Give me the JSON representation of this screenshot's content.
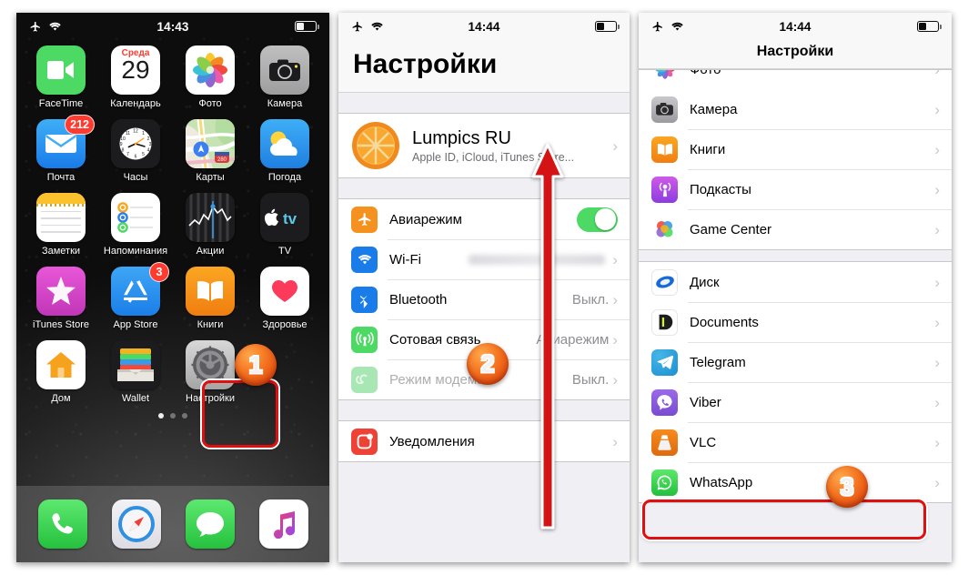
{
  "home_screen": {
    "status": {
      "time": "14:43",
      "airplane_icon": "airplane-mode-icon",
      "wifi_icon": "wifi-icon",
      "battery_icon": "battery-icon"
    },
    "apps": [
      {
        "label": "FaceTime",
        "icon": "facetime-icon",
        "badge": ""
      },
      {
        "label": "Календарь",
        "icon": "calendar-icon",
        "badge": "",
        "weekday": "Среда",
        "day": "29"
      },
      {
        "label": "Фото",
        "icon": "photos-icon",
        "badge": ""
      },
      {
        "label": "Камера",
        "icon": "camera-icon",
        "badge": ""
      },
      {
        "label": "Почта",
        "icon": "mail-icon",
        "badge": "212"
      },
      {
        "label": "Часы",
        "icon": "clock-icon",
        "badge": ""
      },
      {
        "label": "Карты",
        "icon": "maps-icon",
        "badge": "",
        "shield": "280"
      },
      {
        "label": "Погода",
        "icon": "weather-icon",
        "badge": ""
      },
      {
        "label": "Заметки",
        "icon": "notes-icon",
        "badge": ""
      },
      {
        "label": "Напоминания",
        "icon": "reminders-icon",
        "badge": ""
      },
      {
        "label": "Акции",
        "icon": "stocks-icon",
        "badge": ""
      },
      {
        "label": "TV",
        "icon": "apple-tv-icon",
        "badge": ""
      },
      {
        "label": "iTunes Store",
        "icon": "itunes-store-icon",
        "badge": ""
      },
      {
        "label": "App Store",
        "icon": "app-store-icon",
        "badge": "3"
      },
      {
        "label": "Книги",
        "icon": "books-icon",
        "badge": ""
      },
      {
        "label": "Здоровье",
        "icon": "health-icon",
        "badge": ""
      },
      {
        "label": "Дом",
        "icon": "home-app-icon",
        "badge": ""
      },
      {
        "label": "Wallet",
        "icon": "wallet-icon",
        "badge": ""
      },
      {
        "label": "Настройки",
        "icon": "settings-icon",
        "badge": ""
      }
    ],
    "page_dots": {
      "count": 3,
      "active_index": 0
    },
    "dock": [
      {
        "label": "Телефон",
        "icon": "phone-icon"
      },
      {
        "label": "Safari",
        "icon": "safari-icon"
      },
      {
        "label": "Сообщения",
        "icon": "messages-icon"
      },
      {
        "label": "Музыка",
        "icon": "music-icon"
      }
    ]
  },
  "settings_screen": {
    "status": {
      "time": "14:44",
      "airplane_icon": "airplane-mode-icon",
      "wifi_icon": "wifi-icon",
      "battery_icon": "battery-icon"
    },
    "title": "Настройки",
    "account": {
      "name": "Lumpics RU",
      "subtitle": "Apple ID, iCloud, iTunes Store...",
      "avatar_icon": "orange-slice-avatar",
      "chevron": "›"
    },
    "rows": [
      {
        "label": "Авиарежим",
        "icon": "airplane-row-icon",
        "control": "toggle",
        "value": "",
        "enabled": true,
        "dim": false
      },
      {
        "label": "Wi-Fi",
        "icon": "wifi-row-icon",
        "control": "blurred-value",
        "value": "",
        "dim": false
      },
      {
        "label": "Bluetooth",
        "icon": "bluetooth-row-icon",
        "control": "value",
        "value": "Выкл.",
        "dim": false
      },
      {
        "label": "Сотовая связь",
        "icon": "cellular-row-icon",
        "control": "value",
        "value": "Авиарежим",
        "dim": false
      },
      {
        "label": "Режим модема",
        "icon": "hotspot-row-icon",
        "control": "value",
        "value": "Выкл.",
        "dim": true
      }
    ],
    "rows2": [
      {
        "label": "Уведомления",
        "icon": "notifications-row-icon",
        "control": "chevron",
        "value": ""
      }
    ]
  },
  "apps_screen": {
    "status": {
      "time": "14:44",
      "airplane_icon": "airplane-mode-icon",
      "wifi_icon": "wifi-icon",
      "battery_icon": "battery-icon"
    },
    "title": "Настройки",
    "group1": [
      {
        "label": "Фото",
        "icon": "photos-row-icon"
      },
      {
        "label": "Камера",
        "icon": "camera-row-icon"
      },
      {
        "label": "Книги",
        "icon": "books-row-icon"
      },
      {
        "label": "Подкасты",
        "icon": "podcasts-row-icon"
      },
      {
        "label": "Game Center",
        "icon": "gamecenter-row-icon"
      }
    ],
    "group2": [
      {
        "label": "Диск",
        "icon": "drive-row-icon"
      },
      {
        "label": "Documents",
        "icon": "documents-row-icon"
      },
      {
        "label": "Telegram",
        "icon": "telegram-row-icon"
      },
      {
        "label": "Viber",
        "icon": "viber-row-icon"
      },
      {
        "label": "VLC",
        "icon": "vlc-row-icon"
      },
      {
        "label": "WhatsApp",
        "icon": "whatsapp-row-icon"
      }
    ]
  },
  "annotations": {
    "step1": "1",
    "step2": "2",
    "step3": "3",
    "arrow": "scroll-up-arrow",
    "highlight_color": "#e01010",
    "badge_color": "#f4711f"
  }
}
